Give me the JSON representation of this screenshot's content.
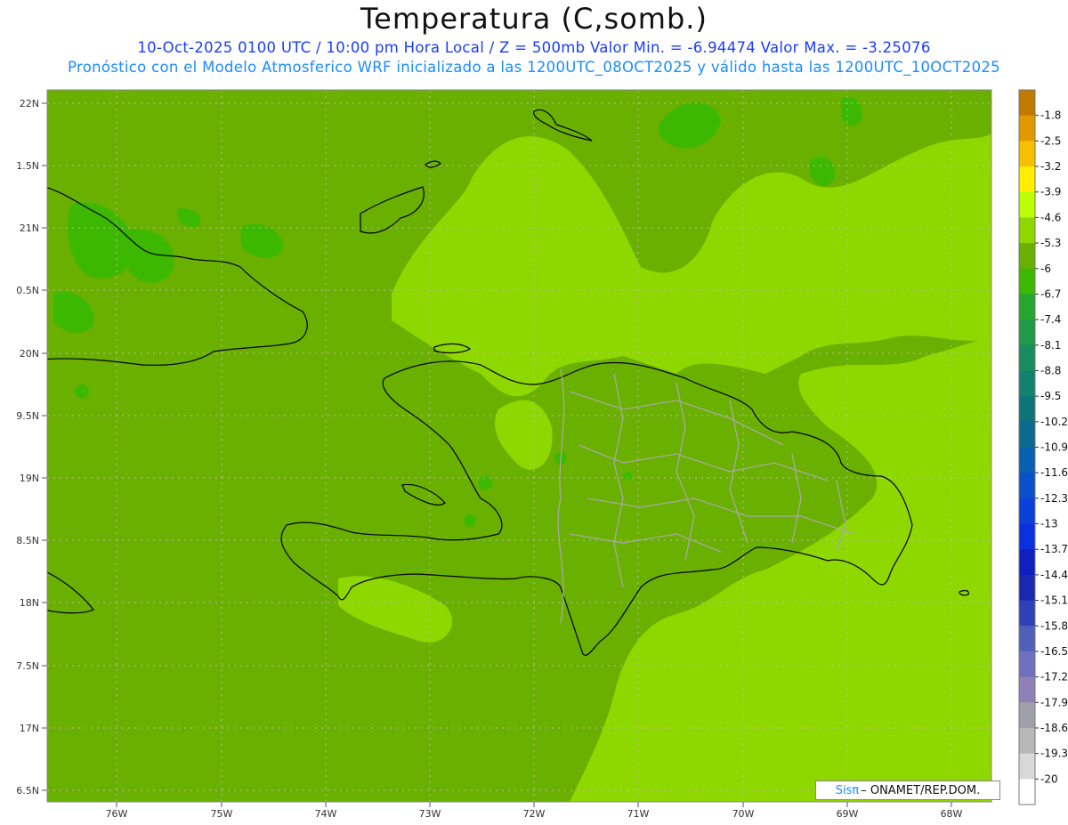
{
  "header": {
    "title": "Temperatura (C,somb.)",
    "line1": "10-Oct-2025  0100 UTC / 10:00 pm Hora Local / Z = 500mb  Valor Min. = -6.94474  Valor Max. = -3.25076",
    "line2": "Pronóstico con el Modelo Atmosferico WRF inicializado a las 1200UTC_08OCT2025 y válido hasta las  1200UTC_10OCT2025"
  },
  "axes": {
    "lat_labels": [
      "22N",
      "1.5N",
      "21N",
      "0.5N",
      "20N",
      "9.5N",
      "19N",
      "8.5N",
      "18N",
      "7.5N",
      "17N",
      "6.5N"
    ],
    "lon_labels": [
      "76W",
      "75W",
      "74W",
      "73W",
      "72W",
      "71W",
      "70W",
      "69W",
      "68W"
    ]
  },
  "colorbar": {
    "labels": [
      "-1.8",
      "-2.5",
      "-3.2",
      "-3.9",
      "-4.6",
      "-5.3",
      "-6",
      "-6.7",
      "-7.4",
      "-8.1",
      "-8.8",
      "-9.5",
      "-10.2",
      "-10.9",
      "-11.6",
      "-12.3",
      "-13",
      "-13.7",
      "-14.4",
      "-15.1",
      "-15.8",
      "-16.5",
      "-17.2",
      "-17.9",
      "-18.6",
      "-19.3",
      "-20"
    ],
    "colors": [
      "#c07a00",
      "#e09a00",
      "#f6c000",
      "#ffee00",
      "#bbff00",
      "#8ed800",
      "#6ab000",
      "#3cb800",
      "#26a830",
      "#1e9a48",
      "#1a8c60",
      "#148070",
      "#0e7478",
      "#0a6a90",
      "#0a60b0",
      "#0a50c8",
      "#0a40d8",
      "#0a30e0",
      "#1020c0",
      "#1a28b0",
      "#3040b8",
      "#5060b8",
      "#7070c0",
      "#9080b8",
      "#a0a0a8",
      "#b8b8b8",
      "#d8d8d8",
      "#ffffff"
    ]
  },
  "credit": {
    "logo": "Sisπ",
    "text": "– ONAMET/REP.DOM."
  }
}
